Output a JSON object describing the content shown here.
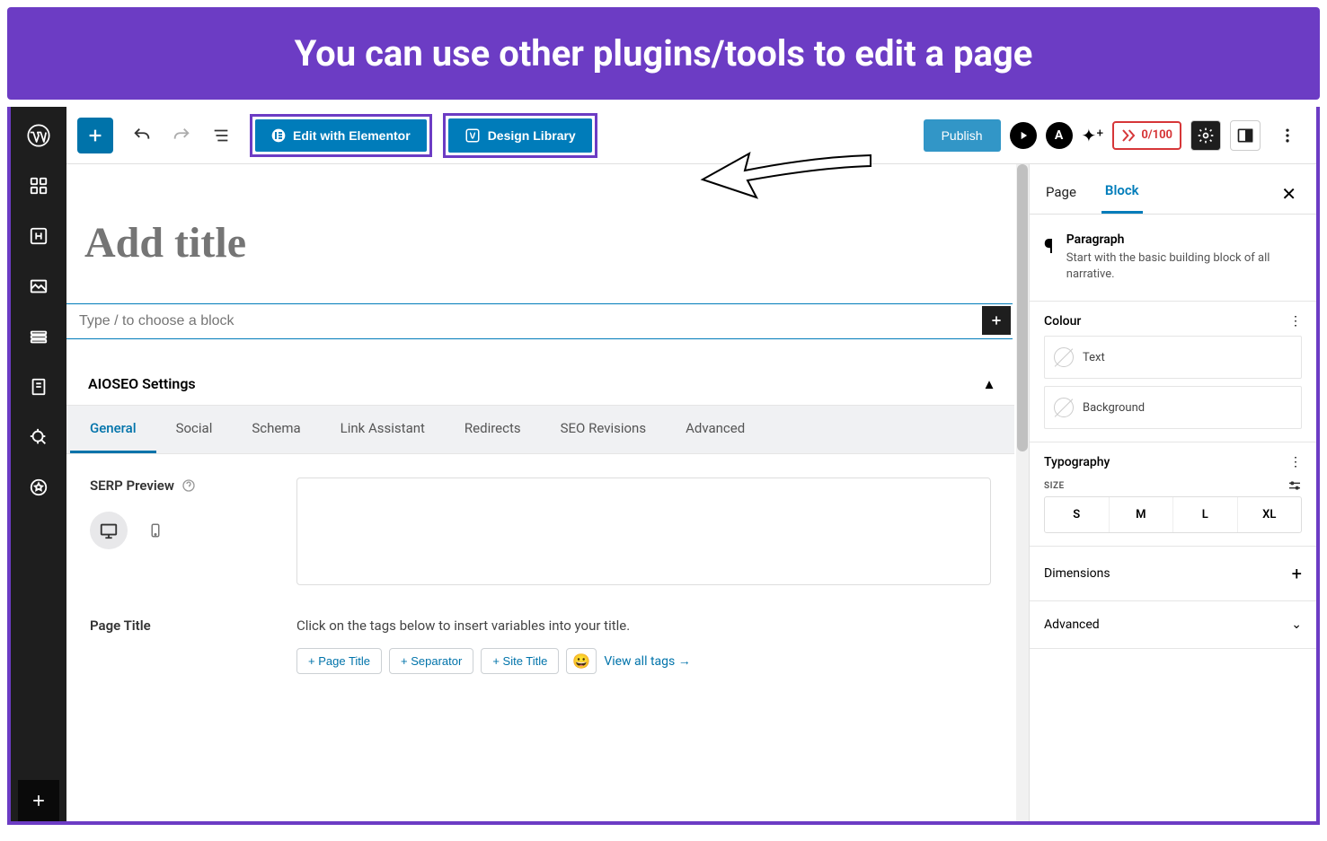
{
  "banner": {
    "text": "You can use other plugins/tools to edit a page"
  },
  "toolbar": {
    "elementor_label": "Edit with Elementor",
    "design_library_label": "Design Library",
    "publish_label": "Publish",
    "score": "0/100"
  },
  "editor": {
    "title_placeholder": "Add title",
    "block_placeholder": "Type / to choose a block"
  },
  "aioseo": {
    "heading": "AIOSEO Settings",
    "tabs": [
      "General",
      "Social",
      "Schema",
      "Link Assistant",
      "Redirects",
      "SEO Revisions",
      "Advanced"
    ],
    "active_tab": "General",
    "serp_label": "SERP Preview",
    "page_title_label": "Page Title",
    "page_title_desc": "Click on the tags below to insert variables into your title.",
    "tags": [
      "+ Page Title",
      "+ Separator",
      "+ Site Title"
    ],
    "view_all": "View all tags →"
  },
  "sidebar": {
    "tabs": {
      "page": "Page",
      "block": "Block"
    },
    "para_title": "Paragraph",
    "para_desc": "Start with the basic building block of all narrative.",
    "colour_label": "Colour",
    "colour_text": "Text",
    "colour_background": "Background",
    "typography_label": "Typography",
    "size_label": "SIZE",
    "sizes": [
      "S",
      "M",
      "L",
      "XL"
    ],
    "dimensions_label": "Dimensions",
    "advanced_label": "Advanced"
  }
}
